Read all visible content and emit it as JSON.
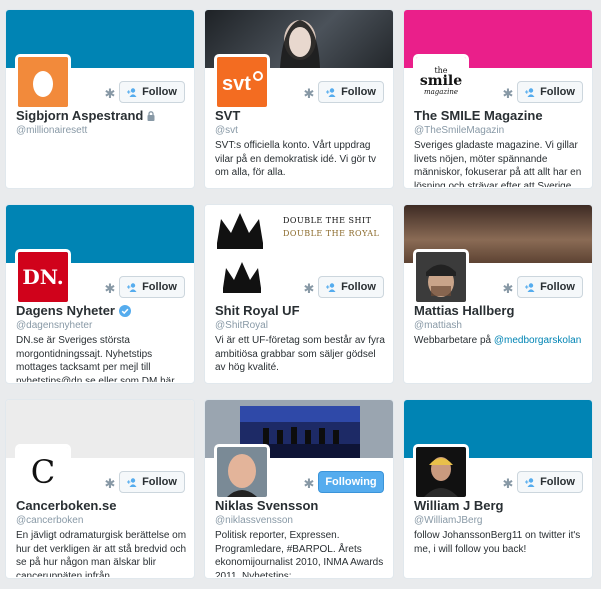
{
  "cards": [
    {
      "name": "Sigbjorn Aspestrand",
      "handle": "@millionairesett",
      "bio": "",
      "follow": "Follow",
      "banner": "#0084b4",
      "protected": true,
      "verified": false
    },
    {
      "name": "SVT",
      "handle": "@svt",
      "bio": "SVT:s officiella konto. Vårt uppdrag vilar på en demokratisk idé. Vi gör tv om alla, för alla.",
      "follow": "Follow",
      "banner": "#2b2f34",
      "logo": "svt"
    },
    {
      "name": "The SMILE Magazine",
      "handle": "@TheSmileMagazin",
      "bio": "Sveriges gladaste magazine. Vi gillar livets nöjen, möter spännande människor, fokuserar på att allt har en lösning och strävar efter att Sverige…",
      "follow": "Follow",
      "banner": "#ea1f8a",
      "logo_lines": [
        "the",
        "smile",
        "magazine"
      ]
    },
    {
      "name": "Dagens Nyheter",
      "handle": "@dagensnyheter",
      "bio": "DN.se är Sveriges största morgontidningssajt. Nyhetstips mottages tacksamt per mejl till nyhetstips@dn.se eller som DM här på Twitter.",
      "follow": "Follow",
      "banner": "#0084b4",
      "verified": true,
      "logo": "DN."
    },
    {
      "name": "Shit Royal UF",
      "handle": "@ShitRoyal",
      "bio": "Vi är ett UF-företag som består av fyra ambitiösa grabbar som säljer gödsel av hög kvalité.",
      "follow": "Follow",
      "banner": "#ffffff",
      "banner_text": [
        "DOUBLE THE SHIT",
        "DOUBLE THE ROYAL"
      ]
    },
    {
      "name": "Mattias Hallberg",
      "handle": "@mattiash",
      "bio_pre": "Webbarbetare på ",
      "bio_link": "@medborgarskolan",
      "follow": "Follow",
      "banner": "#5a4238"
    },
    {
      "name": "Cancerboken.se",
      "handle": "@cancerboken",
      "bio": "En jävligt odramaturgisk berättelse om hur det verkligen är att stå bredvid och se på hur någon man älskar blir canceruppäten infrån.",
      "follow": "Follow",
      "banner": "#ececec",
      "logo": "C"
    },
    {
      "name": "Niklas Svensson",
      "handle": "@niklassvensson",
      "bio": "Politisk reporter, Expressen. Programledare, #BARPOL. Årets ekonomijournalist 2010, INMA Awards 2011. Nyhetstips:…",
      "follow": "Following",
      "banner": "#9aa5b0"
    },
    {
      "name": "William J Berg",
      "handle": "@WilliamJBerg",
      "bio": "follow JohanssonBerg11 on twitter it's me, i will follow you back!",
      "follow": "Follow",
      "banner": "#0084b4"
    }
  ],
  "icons": {
    "settings": "gear-icon",
    "follow": "add-user-icon",
    "lock": "lock-icon",
    "verified": "verified-badge-icon"
  }
}
